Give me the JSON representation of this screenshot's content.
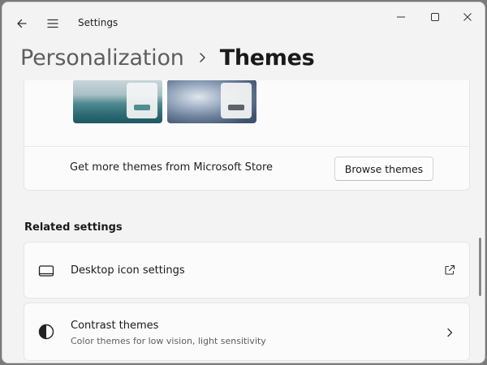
{
  "window": {
    "title": "Settings"
  },
  "breadcrumb": {
    "parent": "Personalization",
    "current": "Themes"
  },
  "themes": {
    "store_text": "Get more themes from Microsoft Store",
    "browse_label": "Browse themes"
  },
  "related": {
    "heading": "Related settings",
    "items": [
      {
        "title": "Desktop icon settings",
        "subtitle": "",
        "icon": "desktop-icon",
        "trailing": "external-link-icon"
      },
      {
        "title": "Contrast themes",
        "subtitle": "Color themes for low vision, light sensitivity",
        "icon": "contrast-icon",
        "trailing": "chevron-right-icon"
      }
    ]
  },
  "colors": {
    "window_bg": "#f3f3f3",
    "card_bg": "#fbfbfb",
    "accent_teal": "#4f8f93"
  }
}
